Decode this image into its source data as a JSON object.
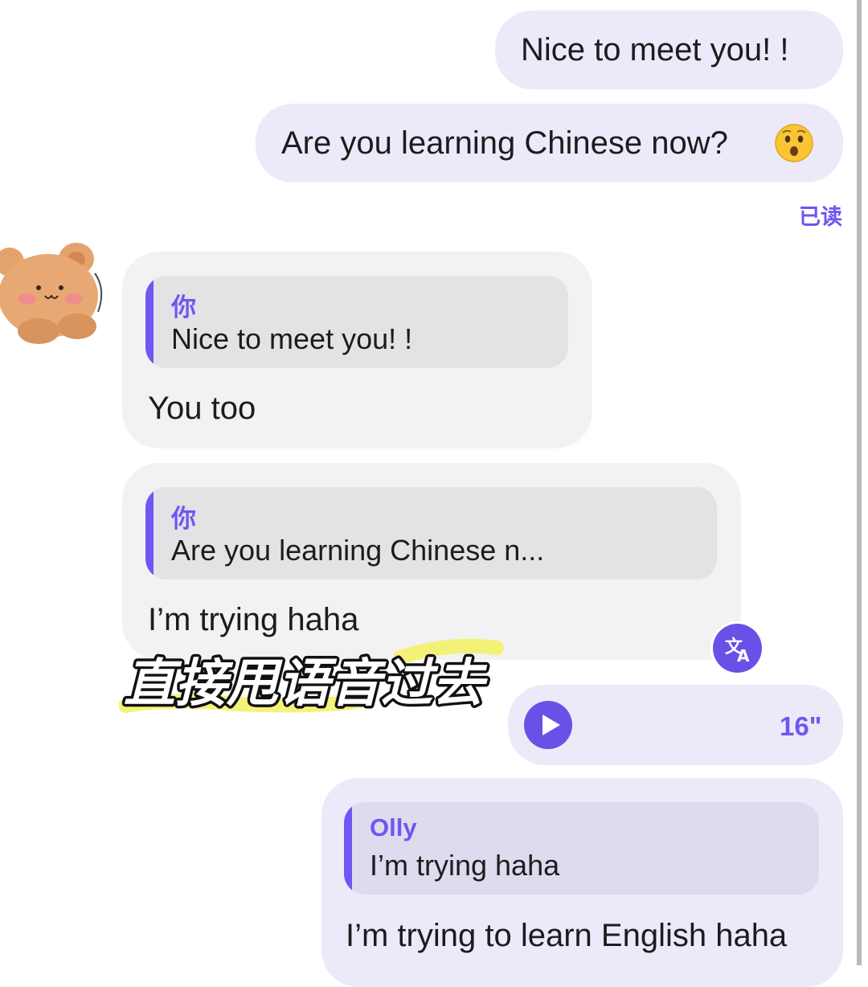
{
  "messages": [
    {
      "direction": "outgoing",
      "text": "Nice to meet you! !"
    },
    {
      "direction": "outgoing",
      "text": "Are you learning Chinese now?",
      "emoji": "astonished-face-icon"
    },
    {
      "direction": "incoming",
      "quote_author": "你",
      "quote_text": "Nice to meet you! !",
      "text": "You too"
    },
    {
      "direction": "incoming",
      "quote_author": "你",
      "quote_text": "Are you learning Chinese n...",
      "text": "I’m trying haha"
    },
    {
      "direction": "outgoing",
      "type": "voice",
      "duration": "16\""
    },
    {
      "direction": "outgoing",
      "quote_author": "Olly",
      "quote_text": "I’m trying haha",
      "text": "I’m trying to learn English haha"
    }
  ],
  "read_status": "已读",
  "overlay_caption": "直接甩语音过去",
  "icons": {
    "avatar": "teddy-bear-avatar",
    "emoji": "astonished-face-icon",
    "translate": "translate-icon",
    "play": "play-icon"
  },
  "colors": {
    "accent": "#7255f2",
    "outgoing_bubble": "#eceaf9",
    "incoming_bubble": "#f2f2f4",
    "highlight": "#f4f16a"
  }
}
